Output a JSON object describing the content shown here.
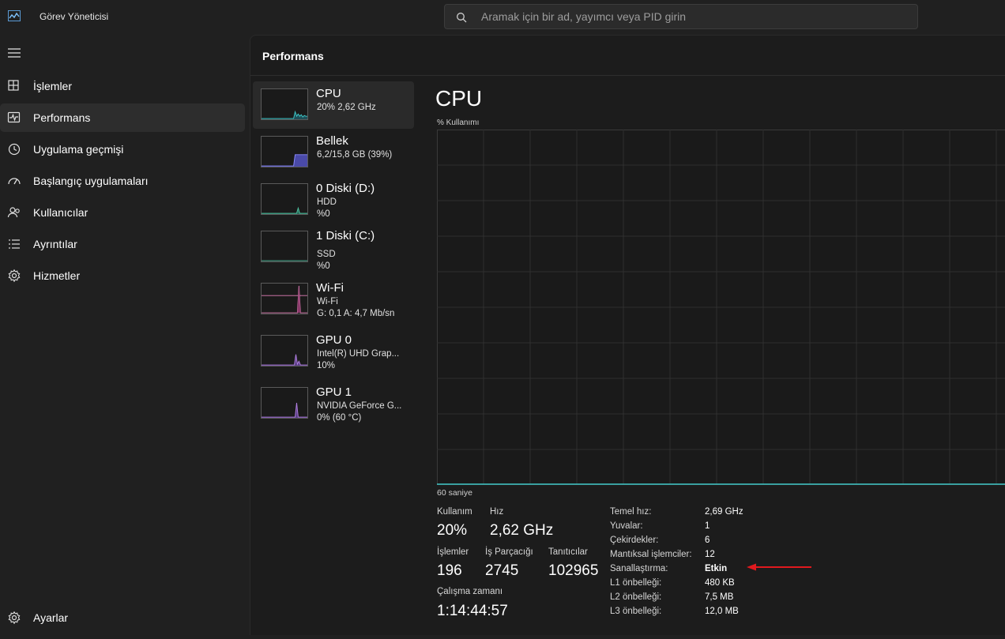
{
  "app": {
    "title": "Görev Yöneticisi",
    "icon": "performance-chart-icon"
  },
  "search": {
    "placeholder": "Aramak için bir ad, yayımcı veya PID girin"
  },
  "sidebar": {
    "items": [
      {
        "label": "İşlemler",
        "icon": "processes-icon"
      },
      {
        "label": "Performans",
        "icon": "performance-icon",
        "active": true
      },
      {
        "label": "Uygulama geçmişi",
        "icon": "history-icon"
      },
      {
        "label": "Başlangıç uygulamaları",
        "icon": "startup-icon"
      },
      {
        "label": "Kullanıcılar",
        "icon": "users-icon"
      },
      {
        "label": "Ayrıntılar",
        "icon": "details-icon"
      },
      {
        "label": "Hizmetler",
        "icon": "services-icon"
      }
    ],
    "settings": {
      "label": "Ayarlar",
      "icon": "gear-icon"
    }
  },
  "page": {
    "title": "Performans"
  },
  "resources": [
    {
      "name": "CPU",
      "line1": "20%  2,62 GHz",
      "line2": "",
      "color": "#3ec6c6"
    },
    {
      "name": "Bellek",
      "line1": "6,2/15,8 GB (39%)",
      "line2": "",
      "color": "#8c8cff"
    },
    {
      "name": "0 Diski (D:)",
      "line1": "HDD",
      "line2": "%0",
      "color": "#4fc3a1"
    },
    {
      "name": "1 Diski (C:)",
      "line1": "SSD",
      "line2": "%0",
      "color": "#4fc3a1"
    },
    {
      "name": "Wi-Fi",
      "line1": "Wi-Fi",
      "line2": "G: 0,1  A: 4,7 Mb/sn",
      "color": "#e27fb8"
    },
    {
      "name": "GPU 0",
      "line1": "Intel(R) UHD Grap...",
      "line2": "10%",
      "color": "#b07ee0"
    },
    {
      "name": "GPU 1",
      "line1": "NVIDIA GeForce G...",
      "line2": "0% (60 °C)",
      "color": "#b07ee0"
    }
  ],
  "cpu": {
    "title": "CPU",
    "usage_axis_label": "% Kullanımı",
    "time_label": "60 saniye",
    "line_color": "#3ec6c6",
    "stats": {
      "usage_label": "Kullanım",
      "usage_value": "20%",
      "speed_label": "Hız",
      "speed_value": "2,62 GHz",
      "processes_label": "İşlemler",
      "processes_value": "196",
      "threads_label": "İş Parçacığı",
      "threads_value": "2745",
      "handles_label": "Tanıtıcılar",
      "handles_value": "102965",
      "uptime_label": "Çalışma zamanı",
      "uptime_value": "1:14:44:57"
    },
    "specs": [
      {
        "label": "Temel hız:",
        "value": "2,69 GHz"
      },
      {
        "label": "Yuvalar:",
        "value": "1"
      },
      {
        "label": "Çekirdekler:",
        "value": "6"
      },
      {
        "label": "Mantıksal işlemciler:",
        "value": "12"
      },
      {
        "label": "Sanallaştırma:",
        "value": "Etkin",
        "bold": true
      },
      {
        "label": "L1 önbelleği:",
        "value": "480 KB"
      },
      {
        "label": "L2 önbelleği:",
        "value": "7,5 MB"
      },
      {
        "label": "L3 önbelleği:",
        "value": "12,0 MB"
      }
    ]
  },
  "annotation": {
    "arrow_color": "#e0191e"
  }
}
